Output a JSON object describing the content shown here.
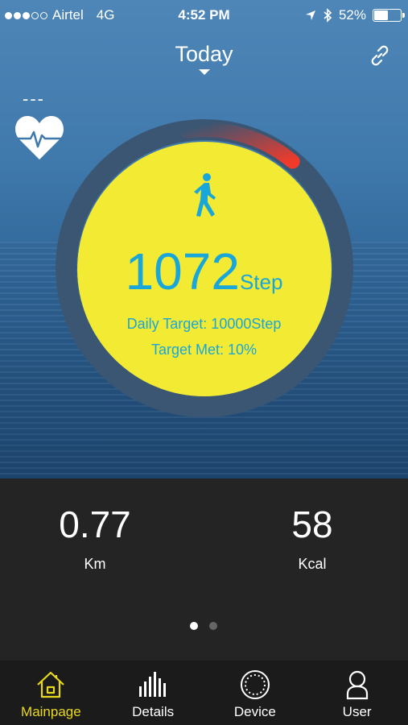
{
  "status_bar": {
    "carrier": "Airtel",
    "network": "4G",
    "time": "4:52 PM",
    "battery": "52%",
    "battery_level": 0.52,
    "signal_bars_filled": 3,
    "signal_bars_total": 5
  },
  "header": {
    "title": "Today",
    "link_icon": "link-icon"
  },
  "heart_rate": {
    "value": "---",
    "icon": "heart-pulse-icon"
  },
  "progress": {
    "steps": "1072",
    "unit": "Step",
    "daily_target": "Daily Target: 10000Step",
    "target_met": "Target Met: 10%",
    "fraction": 0.1,
    "icon": "walking-person-icon",
    "ring_color": "#3b5673",
    "progress_color": "#f23a2a",
    "fill_color": "#f2ea33",
    "text_color": "#19a7d9"
  },
  "stats": {
    "distance_value": "0.77",
    "distance_label": "Km",
    "calories_value": "58",
    "calories_label": "Kcal",
    "pages": 2,
    "active_page": 0
  },
  "tabbar": {
    "tabs": [
      {
        "label": "Mainpage",
        "icon": "home-icon",
        "active": true
      },
      {
        "label": "Details",
        "icon": "bar-chart-icon",
        "active": false
      },
      {
        "label": "Device",
        "icon": "watch-dial-icon",
        "active": false
      },
      {
        "label": "User",
        "icon": "user-icon",
        "active": false
      }
    ],
    "accent": "#e9d91c"
  }
}
